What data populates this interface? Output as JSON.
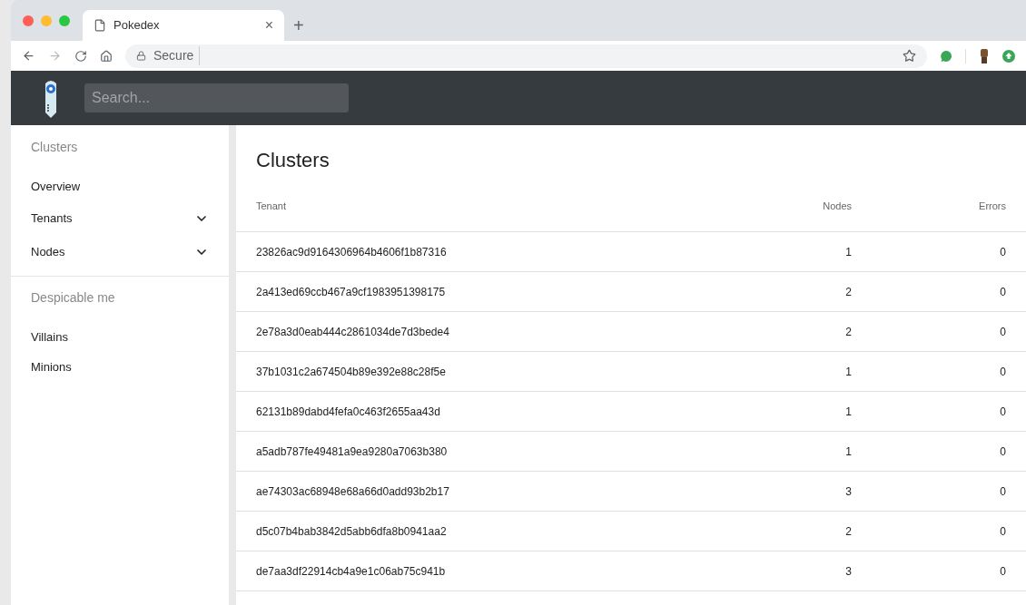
{
  "browser": {
    "tab": {
      "title": "Pokedex",
      "close": "×"
    },
    "new_tab": "+",
    "address": "Secure"
  },
  "header": {
    "search": {
      "placeholder": "Search..."
    }
  },
  "sidebar": {
    "sections": [
      {
        "title": "Clusters",
        "items": [
          {
            "label": "Overview",
            "kind": "link"
          },
          {
            "label": "Tenants",
            "kind": "group",
            "expanded": false
          },
          {
            "label": "Nodes",
            "kind": "group",
            "expanded": false
          }
        ]
      },
      {
        "title": "Despicable me",
        "items": [
          {
            "label": "Villains",
            "kind": "link"
          },
          {
            "label": "Minions",
            "kind": "link"
          }
        ]
      }
    ]
  },
  "main": {
    "title": "Clusters",
    "table": {
      "columns": [
        "Tenant",
        "Nodes",
        "Errors"
      ],
      "rows": [
        [
          "23826ac9d9164306964b4606f1b87316",
          "1",
          "0"
        ],
        [
          "2a413ed69ccb467a9cf1983951398175",
          "2",
          "0"
        ],
        [
          "2e78a3d0eab444c2861034de7d3bede4",
          "2",
          "0"
        ],
        [
          "37b1031c2a674504b89e392e88c28f5e",
          "1",
          "0"
        ],
        [
          "62131b89dabd4fefa0c463f2655aa43d",
          "1",
          "0"
        ],
        [
          "a5adb787fe49481a9ea9280a7063b380",
          "1",
          "0"
        ],
        [
          "ae74303ac68948e68a66d0add93b2b17",
          "3",
          "0"
        ],
        [
          "d5c07b4bab3842d5abb6dfa8b0941aa2",
          "2",
          "0"
        ],
        [
          "de7aa3df22914cb4a9e1c06ab75c941b",
          "3",
          "0"
        ]
      ]
    }
  }
}
